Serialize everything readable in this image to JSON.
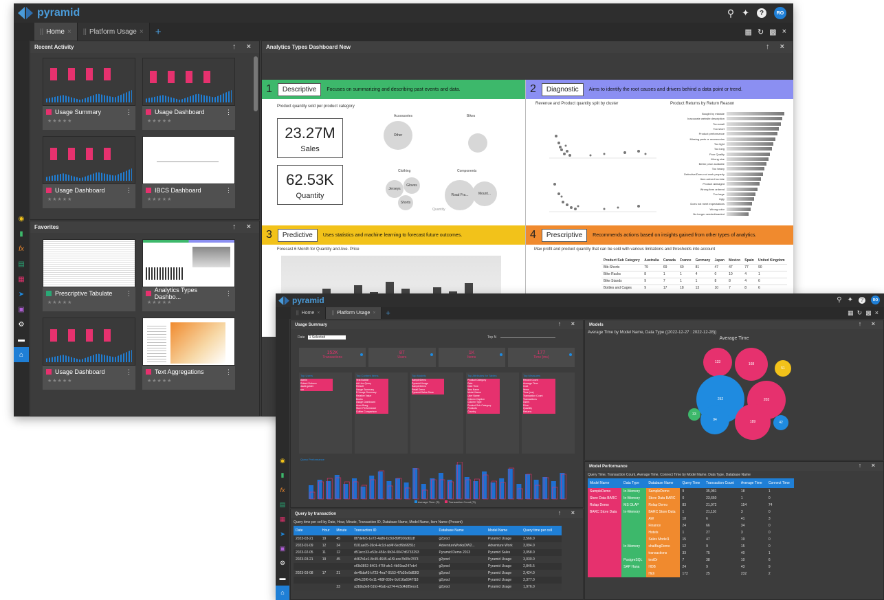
{
  "app": {
    "name": "pyramid",
    "user_initials": "RO"
  },
  "tabs": [
    {
      "label": "Home"
    },
    {
      "label": "Platform Usage"
    }
  ],
  "win1": {
    "recent_activity_title": "Recent Activity",
    "favorites_title": "Favorites",
    "recent_cards": [
      {
        "label": "Usage Summary",
        "color": "#e6316e"
      },
      {
        "label": "Usage Dashboard",
        "color": "#e6316e"
      },
      {
        "label": "Usage Dashboard",
        "color": "#e6316e"
      },
      {
        "label": "IBCS Dashboard",
        "color": "#e6316e"
      }
    ],
    "favorite_cards": [
      {
        "label": "Prescriptive Tabulate",
        "color": "#2aa876"
      },
      {
        "label": "Analytics Types Dashbo...",
        "color": "#e6316e"
      },
      {
        "label": "Usage Dashboard",
        "color": "#e6316e"
      },
      {
        "label": "Text Aggregations",
        "color": "#e6316e"
      }
    ],
    "dashboard_title": "Analytics Types Dashboard New",
    "quads": [
      {
        "num": "1",
        "title": "Descriptive",
        "desc": "Focuses on summarizing and describing past events and data.",
        "color": "#3db86b"
      },
      {
        "num": "2",
        "title": "Diagnostic",
        "desc": "Aims to identify the root causes and drivers behind a data point or trend.",
        "color": "#8b8ff2"
      },
      {
        "num": "3",
        "title": "Predictive",
        "desc": "Uses statistics and machine learning to forecast future outcomes.",
        "color": "#f2c21a"
      },
      {
        "num": "4",
        "title": "Prescriptive",
        "desc": "Recommends actions based on insights gained from other types of analytics.",
        "color": "#f08a2e"
      }
    ],
    "desc_chart_title": "Product quantity sold per product category",
    "kpi_sales": {
      "value": "23.27M",
      "label": "Sales"
    },
    "kpi_qty": {
      "value": "62.53K",
      "label": "Quantity"
    },
    "bubble_groups": [
      "Accessories",
      "Bikes",
      "Clothing",
      "Components"
    ],
    "bubble_labels": [
      "Other",
      "Jerseys",
      "Gloves",
      "Shorts",
      "Road Fra...",
      "Mount..."
    ],
    "quantity_label": "Quantity",
    "diag_chart1_title": "Revenue and Product quantity split by cluster",
    "diag_chart2_title": "Product Returns by Return Reason",
    "return_reasons": [
      "Bought by mistake",
      "Inaccurate website description",
      "Too small",
      "Too short",
      "Product performance",
      "Missing parts or accessories",
      "Too tight",
      "Too long",
      "Poor Quality",
      "Wrong size",
      "Better price available",
      "Too heavy",
      "Defective/Does not work properly",
      "Item arrived too late",
      "Product damaged",
      "Wrong item ordered",
      "Too large",
      "Ugly",
      "Does not meet expectations",
      "Wrong color",
      "No longer needed/wanted"
    ],
    "pred_chart_title": "Forecast 6 Month for Quantity and Ave. Price",
    "presc_chart_title": "Max profit and product quantity that can be sold with various limitations and thresholds into account",
    "presc_cols": [
      "Product Sub Category",
      "Australia",
      "Canada",
      "France",
      "Germany",
      "Japan",
      "Mexico",
      "Spain",
      "United Kingdom"
    ],
    "presc_rows": [
      [
        "Bib-Shorts",
        "79",
        "69",
        "69",
        "81",
        "47",
        "47",
        "77",
        "90"
      ],
      [
        "Bike Racks",
        "8",
        "1",
        "1",
        "4",
        "0",
        "10",
        "4",
        "1"
      ],
      [
        "Bike Stands",
        "9",
        "7",
        "1",
        "1",
        "8",
        "8",
        "4",
        "6"
      ],
      [
        "Bottles and Cages",
        "9",
        "17",
        "18",
        "13",
        "10",
        "7",
        "8",
        "6"
      ]
    ]
  },
  "win2": {
    "usage_summary_title": "Usage Summary",
    "models_title": "Models",
    "models_subtitle": "Average Time by Model Name, Data Type ((2022-12-27 : 2022-12-28))",
    "models_chart_title": "Average Time",
    "filter_date_label": "Date",
    "filter_date_value": "1 Selected",
    "filter_topn_label": "Top N",
    "kpis": [
      {
        "value": "152K",
        "label": "Transactions"
      },
      {
        "value": "87",
        "label": "Users"
      },
      {
        "value": "1K",
        "label": "Items"
      },
      {
        "value": "177",
        "label": "Time (ms)"
      }
    ],
    "top_lists": [
      {
        "title": "Top Users",
        "items": [
          "Admin",
          "Robert Dobson",
          "david.golder",
          "ron"
        ]
      },
      {
        "title": "Top Content Items",
        "items": [
          "Test Bubble",
          "Ad Hoc Query",
          "Rebuilt",
          "Usage Summary",
          "D Usage Summary",
          "Relative Value",
          "Books",
          "Usage Dashboard",
          "Anne Boeg",
          "Store Performance",
          "Coffee Comparison"
        ]
      },
      {
        "title": "Top Models",
        "items": [
          "SampleDemo",
          "Pyramid Usage",
          "SampleDemo",
          "Retail Demo",
          "Pyramid Sales Store"
        ]
      },
      {
        "title": "Top Attributes for Tables",
        "items": [
          "Product Category",
          "Date",
          "Date Time",
          "Item Name",
          "Model Name",
          "User Name",
          "Column Caption",
          "Column Type",
          "Product Sub Category",
          "Products",
          "Country"
        ]
      },
      {
        "title": "Top Measures",
        "items": [
          "Record Count",
          "Average Time",
          "Cost",
          "Items",
          "Time (ms)",
          "Transaction Count",
          "Transactions",
          "Users",
          "Price",
          "Quantity",
          "Returns"
        ]
      }
    ],
    "query_perf_title": "Query Performance",
    "legend_avg": "Average Time (Ti)",
    "legend_count": "Transaction Count (Ti)",
    "qbt_title": "Query by transaction",
    "qbt_subtitle": "Query time per cell by Date, Hour, Minute, Transaction ID, Database Name, Model Name, Item Name (Present)",
    "qbt_cols": [
      "Date",
      "Hour",
      "Minute",
      "Transaction ID",
      "Database Name",
      "Model Name",
      "Query time per cell"
    ],
    "qbt_rows": [
      [
        "2023-03-21",
        "19",
        "45",
        "8f7defe5-1e72-4a86-bc8d-89ff106d61df",
        "g2prod",
        "Pyramid Usage",
        "3,566.0"
      ],
      [
        "2023-01-09",
        "12",
        "34",
        "f101aa05-26c4-4c1d-ad4f-6ecf6b6f281c",
        "AdventureWorksDW2...",
        "Adventure Work",
        "3,094.0"
      ],
      [
        "2023-02-05",
        "11",
        "12",
        "d51ecc33-e53c-456c-9b34-0047d6733293",
        "Pyramid Demo 2013",
        "Pyramid Sales",
        "3,058.0"
      ],
      [
        "2023-03-21",
        "19",
        "45",
        "d467b1e1-8c49-4645-a1f9-ece7b09c7873",
        "g2prod",
        "Pyramid Usage",
        "3,030.0"
      ],
      [
        "",
        "",
        "",
        "ef3b3852-8401-475f-afc1-4b59aa247eb4",
        "g2prod",
        "Pyramid Usage",
        "2,845.5"
      ],
      [
        "2023-03-08",
        "17",
        "21",
        "de46da43-b723-4ea7-9153-47b35e9d83f3",
        "g2prod",
        "Pyramid Usage",
        "2,424.0"
      ],
      [
        "",
        "",
        "",
        "d94c33f6-0e11-468f-839e-9c616a6947f18",
        "g2prod",
        "Pyramid Usage",
        "2,377.0"
      ],
      [
        "",
        "",
        "23",
        "a2b9a3e8-51fd-40ab-a374-4c5d4d85ece1",
        "g2prod",
        "Pyramid Usage",
        "1,976.0"
      ]
    ],
    "mp_title": "Model Performance",
    "mp_subtitle": "Query Time, Transaction Count, Average Time, Connect Time by Model Name, Data Type, Database Name",
    "mp_cols": [
      "Model Name",
      "Data Type",
      "Database Name",
      "Query Time",
      "Transaction Count",
      "Average Time",
      "Connect Time"
    ],
    "mp_rows": [
      [
        "SampleDemo",
        "In-Memory",
        "SampleDemo",
        "9",
        "35,981",
        "18",
        "1"
      ],
      [
        "Store Data BARC",
        "In-Memory",
        "Store Data BARC",
        "0",
        "23,660",
        "1",
        "0"
      ],
      [
        "Rolap Demo",
        "MS OLAP",
        "Rolap Demo",
        "83",
        "21,972",
        "154",
        "74"
      ],
      [
        "BARC Store Data",
        "In-Memory",
        "BARC Store Data",
        "1",
        "21,116",
        "3",
        "0"
      ],
      [
        "",
        "",
        "AW",
        "18",
        "6",
        "41",
        "3"
      ],
      [
        "",
        "",
        "Finance",
        "24",
        "66",
        "34",
        "0"
      ],
      [
        "",
        "",
        "Hotels",
        "1",
        "27",
        "3",
        "0"
      ],
      [
        "",
        "",
        "Sales Model1",
        "15",
        "47",
        "19",
        "0"
      ],
      [
        "",
        "In-Memory",
        "shaiBugDemo",
        "12",
        "9",
        "15",
        "0"
      ],
      [
        "",
        "",
        "transactions",
        "33",
        "75",
        "40",
        "1"
      ],
      [
        "",
        "PostgreSQL",
        "testDr",
        "7",
        "38",
        "10",
        "6"
      ],
      [
        "",
        "SAP Hana",
        "HDB",
        "24",
        "9",
        "43",
        "9"
      ],
      [
        "",
        "",
        "Hidi",
        "172",
        "25",
        "232",
        "2"
      ]
    ],
    "bubbles": [
      {
        "v": "133",
        "c": "#e6316e"
      },
      {
        "v": "168",
        "c": "#e6316e"
      },
      {
        "v": "51",
        "c": "#f2c21a"
      },
      {
        "v": "252",
        "c": "#1f8be0"
      },
      {
        "v": "203",
        "c": "#e6316e"
      },
      {
        "v": "33",
        "c": "#3db86b"
      },
      {
        "v": "94",
        "c": "#1f8be0"
      },
      {
        "v": "189",
        "c": "#e6316e"
      },
      {
        "v": "42",
        "c": "#1f8be0"
      }
    ]
  },
  "colors": {
    "accent": "#1f7fd6",
    "pink": "#e6316e",
    "orange": "#f08a2e",
    "green": "#3db86b",
    "blue": "#1f8be0"
  }
}
